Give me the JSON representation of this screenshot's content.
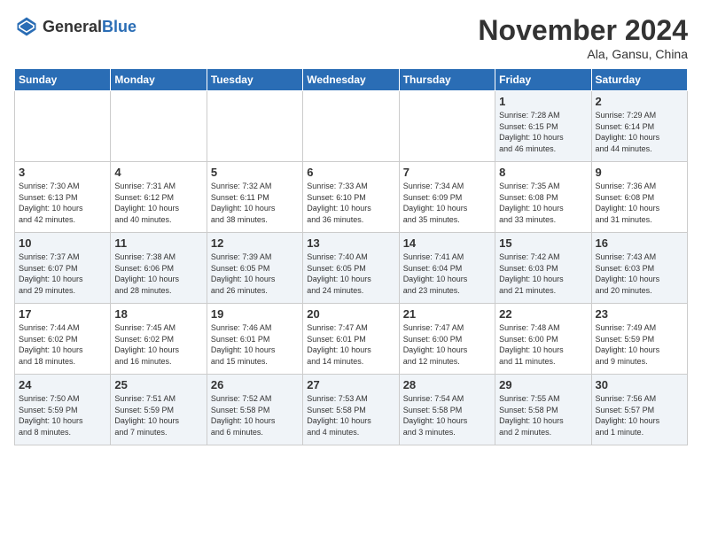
{
  "header": {
    "logo_general": "General",
    "logo_blue": "Blue",
    "title": "November 2024",
    "location": "Ala, Gansu, China"
  },
  "days_of_week": [
    "Sunday",
    "Monday",
    "Tuesday",
    "Wednesday",
    "Thursday",
    "Friday",
    "Saturday"
  ],
  "weeks": [
    [
      {
        "day": "",
        "info": ""
      },
      {
        "day": "",
        "info": ""
      },
      {
        "day": "",
        "info": ""
      },
      {
        "day": "",
        "info": ""
      },
      {
        "day": "",
        "info": ""
      },
      {
        "day": "1",
        "info": "Sunrise: 7:28 AM\nSunset: 6:15 PM\nDaylight: 10 hours\nand 46 minutes."
      },
      {
        "day": "2",
        "info": "Sunrise: 7:29 AM\nSunset: 6:14 PM\nDaylight: 10 hours\nand 44 minutes."
      }
    ],
    [
      {
        "day": "3",
        "info": "Sunrise: 7:30 AM\nSunset: 6:13 PM\nDaylight: 10 hours\nand 42 minutes."
      },
      {
        "day": "4",
        "info": "Sunrise: 7:31 AM\nSunset: 6:12 PM\nDaylight: 10 hours\nand 40 minutes."
      },
      {
        "day": "5",
        "info": "Sunrise: 7:32 AM\nSunset: 6:11 PM\nDaylight: 10 hours\nand 38 minutes."
      },
      {
        "day": "6",
        "info": "Sunrise: 7:33 AM\nSunset: 6:10 PM\nDaylight: 10 hours\nand 36 minutes."
      },
      {
        "day": "7",
        "info": "Sunrise: 7:34 AM\nSunset: 6:09 PM\nDaylight: 10 hours\nand 35 minutes."
      },
      {
        "day": "8",
        "info": "Sunrise: 7:35 AM\nSunset: 6:08 PM\nDaylight: 10 hours\nand 33 minutes."
      },
      {
        "day": "9",
        "info": "Sunrise: 7:36 AM\nSunset: 6:08 PM\nDaylight: 10 hours\nand 31 minutes."
      }
    ],
    [
      {
        "day": "10",
        "info": "Sunrise: 7:37 AM\nSunset: 6:07 PM\nDaylight: 10 hours\nand 29 minutes."
      },
      {
        "day": "11",
        "info": "Sunrise: 7:38 AM\nSunset: 6:06 PM\nDaylight: 10 hours\nand 28 minutes."
      },
      {
        "day": "12",
        "info": "Sunrise: 7:39 AM\nSunset: 6:05 PM\nDaylight: 10 hours\nand 26 minutes."
      },
      {
        "day": "13",
        "info": "Sunrise: 7:40 AM\nSunset: 6:05 PM\nDaylight: 10 hours\nand 24 minutes."
      },
      {
        "day": "14",
        "info": "Sunrise: 7:41 AM\nSunset: 6:04 PM\nDaylight: 10 hours\nand 23 minutes."
      },
      {
        "day": "15",
        "info": "Sunrise: 7:42 AM\nSunset: 6:03 PM\nDaylight: 10 hours\nand 21 minutes."
      },
      {
        "day": "16",
        "info": "Sunrise: 7:43 AM\nSunset: 6:03 PM\nDaylight: 10 hours\nand 20 minutes."
      }
    ],
    [
      {
        "day": "17",
        "info": "Sunrise: 7:44 AM\nSunset: 6:02 PM\nDaylight: 10 hours\nand 18 minutes."
      },
      {
        "day": "18",
        "info": "Sunrise: 7:45 AM\nSunset: 6:02 PM\nDaylight: 10 hours\nand 16 minutes."
      },
      {
        "day": "19",
        "info": "Sunrise: 7:46 AM\nSunset: 6:01 PM\nDaylight: 10 hours\nand 15 minutes."
      },
      {
        "day": "20",
        "info": "Sunrise: 7:47 AM\nSunset: 6:01 PM\nDaylight: 10 hours\nand 14 minutes."
      },
      {
        "day": "21",
        "info": "Sunrise: 7:47 AM\nSunset: 6:00 PM\nDaylight: 10 hours\nand 12 minutes."
      },
      {
        "day": "22",
        "info": "Sunrise: 7:48 AM\nSunset: 6:00 PM\nDaylight: 10 hours\nand 11 minutes."
      },
      {
        "day": "23",
        "info": "Sunrise: 7:49 AM\nSunset: 5:59 PM\nDaylight: 10 hours\nand 9 minutes."
      }
    ],
    [
      {
        "day": "24",
        "info": "Sunrise: 7:50 AM\nSunset: 5:59 PM\nDaylight: 10 hours\nand 8 minutes."
      },
      {
        "day": "25",
        "info": "Sunrise: 7:51 AM\nSunset: 5:59 PM\nDaylight: 10 hours\nand 7 minutes."
      },
      {
        "day": "26",
        "info": "Sunrise: 7:52 AM\nSunset: 5:58 PM\nDaylight: 10 hours\nand 6 minutes."
      },
      {
        "day": "27",
        "info": "Sunrise: 7:53 AM\nSunset: 5:58 PM\nDaylight: 10 hours\nand 4 minutes."
      },
      {
        "day": "28",
        "info": "Sunrise: 7:54 AM\nSunset: 5:58 PM\nDaylight: 10 hours\nand 3 minutes."
      },
      {
        "day": "29",
        "info": "Sunrise: 7:55 AM\nSunset: 5:58 PM\nDaylight: 10 hours\nand 2 minutes."
      },
      {
        "day": "30",
        "info": "Sunrise: 7:56 AM\nSunset: 5:57 PM\nDaylight: 10 hours\nand 1 minute."
      }
    ]
  ]
}
